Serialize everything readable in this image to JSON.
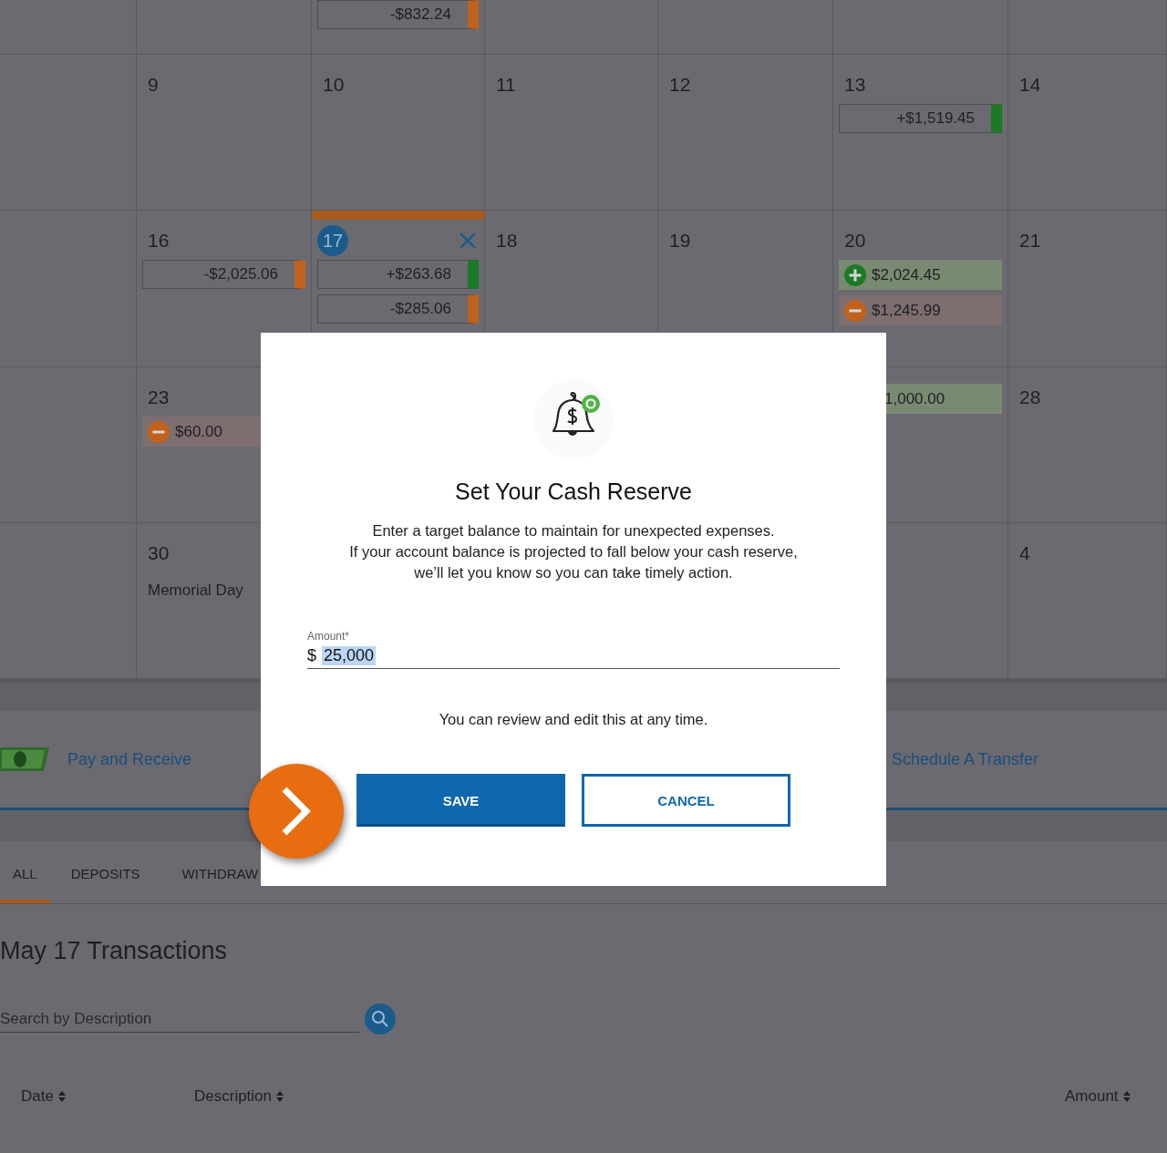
{
  "calendar": {
    "weeks": [
      {
        "days": [
          {
            "selected": false
          },
          {
            "selected": false
          },
          {
            "selected": false,
            "events": [
              {
                "kind": "withdrawal",
                "amount": "-$832.24"
              }
            ]
          },
          {
            "selected": false
          },
          {
            "selected": false
          },
          {
            "selected": false
          },
          {
            "selected": false
          }
        ]
      },
      {
        "days": [
          {
            "selected": false
          },
          {
            "selected": false,
            "day": "9"
          },
          {
            "selected": false,
            "day": "10"
          },
          {
            "selected": false,
            "day": "11"
          },
          {
            "selected": false,
            "day": "12"
          },
          {
            "selected": false,
            "day": "13",
            "events": [
              {
                "kind": "deposit",
                "amount": "+$1,519.45"
              }
            ]
          },
          {
            "selected": false,
            "day": "14"
          }
        ]
      },
      {
        "days": [
          {
            "selected": false
          },
          {
            "selected": false,
            "day": "16",
            "events": [
              {
                "kind": "withdrawal",
                "amount": "-$2,025.06"
              }
            ]
          },
          {
            "selected": true,
            "day": "17",
            "events": [
              {
                "kind": "deposit",
                "amount": "+$263.68"
              },
              {
                "kind": "withdrawal",
                "amount": "-$285.06"
              }
            ]
          },
          {
            "selected": false,
            "day": "18"
          },
          {
            "selected": false,
            "day": "19"
          },
          {
            "selected": false,
            "day": "20",
            "events": [
              {
                "kind": "income",
                "amount": "$2,024.45"
              },
              {
                "kind": "expense",
                "amount": "$1,245.99"
              }
            ]
          },
          {
            "selected": false,
            "day": "21"
          }
        ]
      },
      {
        "days": [
          {
            "selected": false
          },
          {
            "selected": false,
            "day": "23",
            "events": [
              {
                "kind": "expense",
                "amount": "$60.00"
              }
            ]
          }
        ],
        "right_days": [
          {
            "selected": false,
            "events": [
              {
                "kind": "income-cut",
                "amount": "1,000.00"
              }
            ]
          },
          {
            "selected": false,
            "day": "28"
          }
        ]
      },
      {
        "days": [
          {
            "selected": false
          },
          {
            "selected": false,
            "day": "30",
            "note": "Memorial Day"
          }
        ],
        "right_days": [
          {
            "selected": false
          },
          {
            "selected": false,
            "day": "4"
          }
        ]
      }
    ]
  },
  "actions": [
    {
      "kind": "pay",
      "label": "Pay and Receive"
    },
    {
      "kind": "transfer",
      "label": "Schedule A Transfer"
    }
  ],
  "tabs": [
    {
      "label": "ALL",
      "selected": true
    },
    {
      "label": "DEPOSITS",
      "selected": false
    },
    {
      "label": "WITHDRAW",
      "selected": false
    }
  ],
  "transactions": {
    "title": "May 17 Transactions",
    "search": {
      "placeholder": "Search by Description"
    },
    "columns": [
      "Date",
      "Description",
      "Amount"
    ]
  },
  "modal": {
    "title": "Set Your Cash Reserve",
    "description": "Enter a target balance to maintain for unexpected expenses.\nIf your account balance is projected to fall below your cash reserve,\nwe’ll let you know so you can take timely action.",
    "field": {
      "label": "Amount*",
      "prefix": "$",
      "value": "25,000",
      "value_selected": true
    },
    "note": "You can review and edit this at any time.",
    "buttons": [
      {
        "kind": "primary",
        "label": "SAVE"
      },
      {
        "kind": "secondary",
        "label": "CANCEL"
      }
    ]
  }
}
